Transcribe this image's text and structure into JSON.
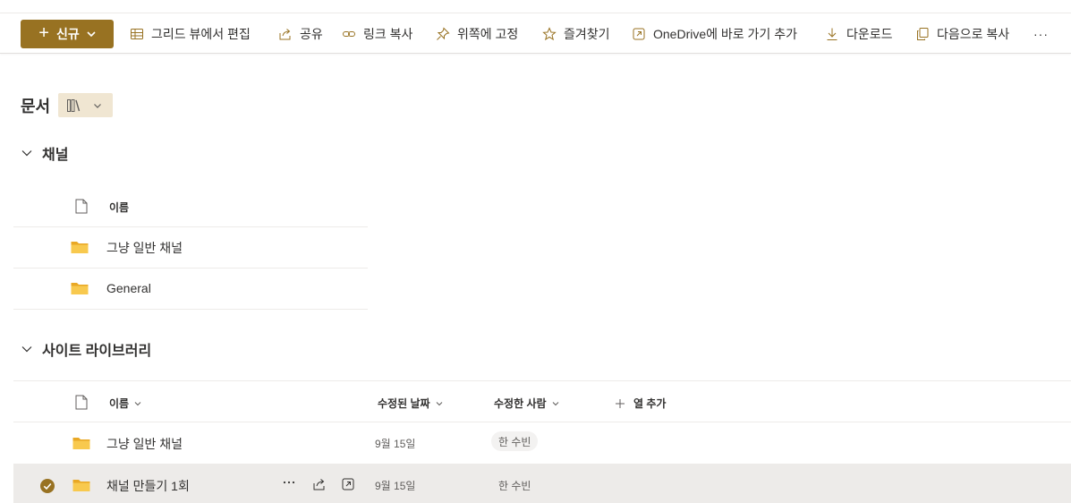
{
  "toolbar": {
    "new_label": "신규",
    "items": [
      {
        "label": "그리드 뷰에서 편집",
        "icon": "grid-icon"
      },
      {
        "label": "공유",
        "icon": "share-icon"
      },
      {
        "label": "링크 복사",
        "icon": "link-icon"
      },
      {
        "label": "위쪽에 고정",
        "icon": "pin-icon"
      },
      {
        "label": "즐겨찾기",
        "icon": "star-icon"
      },
      {
        "label": "OneDrive에 바로 가기 추가",
        "icon": "shortcut-icon"
      },
      {
        "label": "다운로드",
        "icon": "download-icon"
      },
      {
        "label": "다음으로 복사",
        "icon": "copy-icon"
      }
    ],
    "more": "···"
  },
  "page": {
    "title": "문서"
  },
  "channels": {
    "heading": "채널",
    "col_name": "이름",
    "rows": [
      "그냥 일반 채널",
      "General"
    ]
  },
  "library": {
    "heading": "사이트 라이브러리",
    "columns": {
      "name": "이름",
      "modified": "수정된 날짜",
      "modified_by": "수정한 사람",
      "add_column": "열 추가"
    },
    "rows": [
      {
        "name": "그냥 일반 채널",
        "modified": "9월 15일",
        "modified_by": "한 수빈",
        "selected": false
      },
      {
        "name": "채널 만들기 1회",
        "modified": "9월 15일",
        "modified_by": "한 수빈",
        "selected": true
      }
    ]
  },
  "colors": {
    "accent": "#987222",
    "folder": "#f3c04e",
    "selected_bg": "#edebe9"
  }
}
